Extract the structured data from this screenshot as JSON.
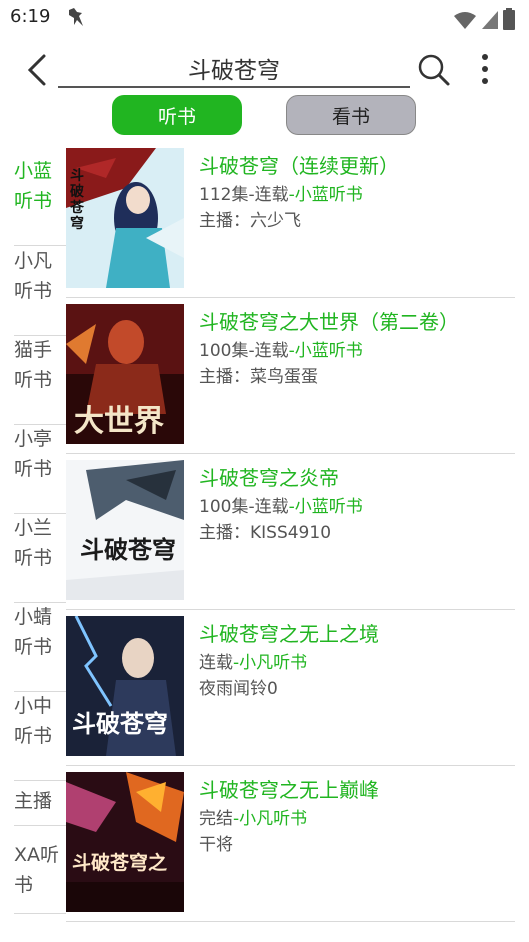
{
  "status_bar": {
    "time": "6:19",
    "icons": [
      "bird-icon",
      "wifi-icon",
      "signal-icon",
      "battery-icon"
    ]
  },
  "search": {
    "query": "斗破苍穹",
    "back_icon": "chevron-left-icon",
    "search_icon": "search-icon",
    "more_icon": "more-vertical-icon"
  },
  "mode_tabs": [
    {
      "label": "听书",
      "active": true
    },
    {
      "label": "看书",
      "active": false
    }
  ],
  "sources": [
    {
      "label": "小蓝听书",
      "active": true
    },
    {
      "label": "小凡听书",
      "active": false
    },
    {
      "label": "猫手听书",
      "active": false
    },
    {
      "label": "小亭听书",
      "active": false
    },
    {
      "label": "小兰听书",
      "active": false
    },
    {
      "label": "小蜻听书",
      "active": false
    },
    {
      "label": "小中听书",
      "active": false
    },
    {
      "label": "主播",
      "active": false
    },
    {
      "label": "XA听书",
      "active": false
    }
  ],
  "books": [
    {
      "title": "斗破苍穹（连续更新）",
      "status": "112集-连载",
      "source": "-小蓝听书",
      "host": "主播：六少飞",
      "cover_text": "斗破苍穹"
    },
    {
      "title": "斗破苍穹之大世界（第二卷）",
      "status": "100集-连载",
      "source": "-小蓝听书",
      "host": "主播：菜鸟蛋蛋",
      "cover_text": "大世界"
    },
    {
      "title": "斗破苍穹之炎帝",
      "status": "100集-连载",
      "source": "-小蓝听书",
      "host": "主播：KISS4910",
      "cover_text": "斗破苍穹"
    },
    {
      "title": "斗破苍穹之无上之境",
      "status": "连载",
      "source": "-小凡听书",
      "host": "夜雨闻铃0",
      "cover_text": "斗破苍穹"
    },
    {
      "title": "斗破苍穹之无上巅峰",
      "status": "完结",
      "source": "-小凡听书",
      "host": "干将",
      "cover_text": "斗破苍穹之"
    }
  ],
  "colors": {
    "accent": "#21b521",
    "tab_inactive": "#b3b3bb",
    "text": "#555555",
    "divider": "#d9d9d9"
  }
}
